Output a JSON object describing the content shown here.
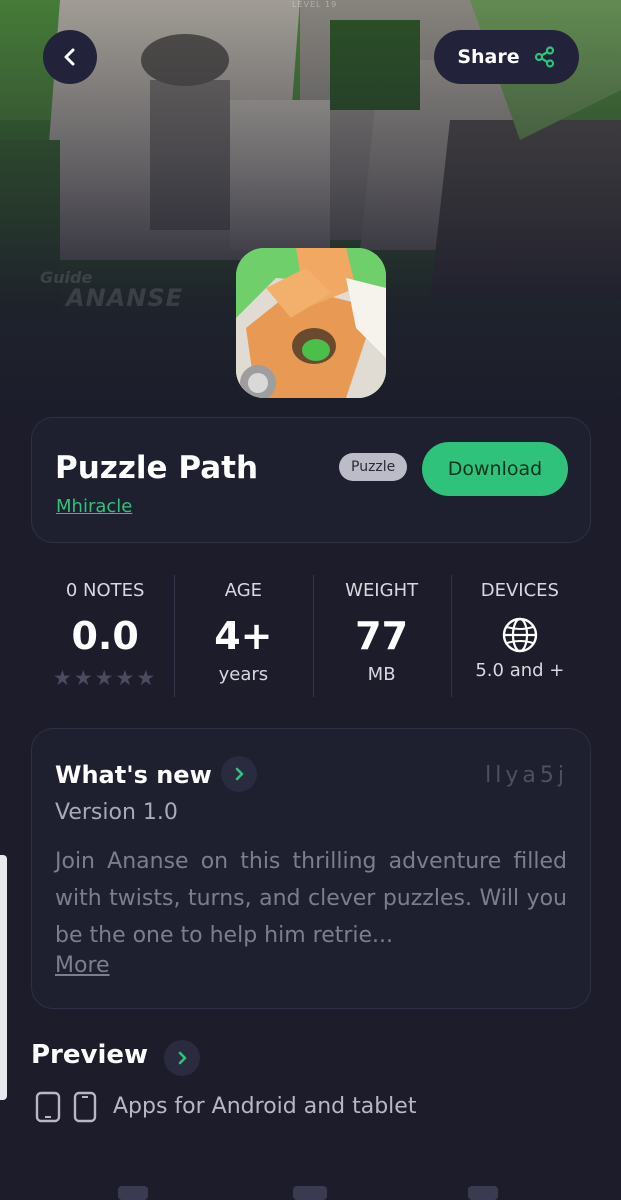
{
  "hero": {
    "level_text": "LEVEL 19",
    "watermark_small": "Guide",
    "watermark_big": "ANANSE"
  },
  "header": {
    "share_label": "Share"
  },
  "app": {
    "title": "Puzzle Path",
    "developer": "Mhiracle",
    "category": "Puzzle",
    "download_label": "Download"
  },
  "stats": {
    "notes_label": "0 NOTES",
    "rating": "0.0",
    "stars_total": 5,
    "age_label": "AGE",
    "age_value": "4+",
    "age_sub": "years",
    "weight_label": "WEIGHT",
    "weight_value": "77",
    "weight_sub": "MB",
    "devices_label": "DEVICES",
    "devices_sub": "5.0 and +"
  },
  "whats_new": {
    "title": "What's new",
    "code": "llya5j",
    "version": "Version 1.0",
    "description": "Join Ananse on this thrilling adventure filled with twists, turns, and clever puzzles. Will you be the one to help him retrie...",
    "more_label": "More"
  },
  "preview": {
    "title": "Preview",
    "devices_text": "Apps for Android and tablet"
  },
  "colors": {
    "background": "#1c1c2b",
    "accent_green": "#2fc27b",
    "card_border": "#2f3045"
  }
}
